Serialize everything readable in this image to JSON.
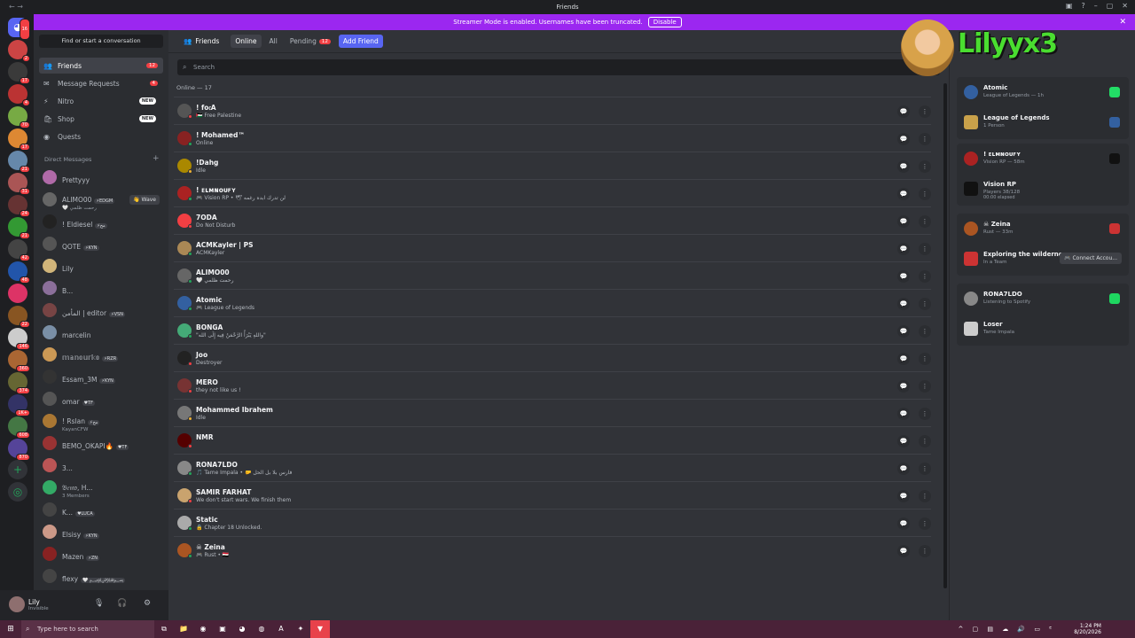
{
  "window": {
    "title": "Friends"
  },
  "banner": {
    "text": "Streamer Mode is enabled. Usernames have been truncated.",
    "disable_label": "Disable"
  },
  "rail": {
    "servers": [
      {
        "badge": "16",
        "color": "#5865f2",
        "home": true
      },
      {
        "badge": "2",
        "color": "#c44"
      },
      {
        "badge": "17",
        "color": "#3a3a3a"
      },
      {
        "badge": "4",
        "color": "#b33"
      },
      {
        "badge": "70",
        "color": "#7a4"
      },
      {
        "badge": "17",
        "color": "#d83"
      },
      {
        "badge": "21",
        "color": "#68a"
      },
      {
        "badge": "31",
        "color": "#a55"
      },
      {
        "badge": "24",
        "color": "#633"
      },
      {
        "badge": "21",
        "color": "#393"
      },
      {
        "badge": "42",
        "color": "#444"
      },
      {
        "badge": "48",
        "color": "#25a"
      },
      {
        "badge": "",
        "color": "#d36"
      },
      {
        "badge": "22",
        "color": "#852"
      },
      {
        "badge": "146",
        "color": "#ccc"
      },
      {
        "badge": "360",
        "color": "#a63"
      },
      {
        "badge": "374",
        "color": "#663"
      },
      {
        "badge": "1K+",
        "color": "#336"
      },
      {
        "badge": "608",
        "color": "#474"
      },
      {
        "badge": "870",
        "color": "#549"
      }
    ],
    "add_symbol": "+",
    "discover_symbol": "◎"
  },
  "sidebar": {
    "find_label": "Find or start a conversation",
    "nav": [
      {
        "label": "Friends",
        "icon": "👥",
        "pill": "12",
        "active": true
      },
      {
        "label": "Message Requests",
        "icon": "✉",
        "pill": "4"
      },
      {
        "label": "Nitro",
        "icon": "⚡",
        "new": "NEW"
      },
      {
        "label": "Shop",
        "icon": "🛍",
        "new": "NEW"
      },
      {
        "label": "Quests",
        "icon": "◉"
      }
    ],
    "dm_header": "Direct Messages",
    "dm_add": "+",
    "dms": [
      {
        "name": "Prettyyy",
        "color": "#b06aa8"
      },
      {
        "name": "ALIMO00",
        "tag": "⚡EDGM",
        "sub": "🤍 رحمت ظلمي",
        "wave": "👋 Wave",
        "color": "#666"
      },
      {
        "name": "! Eldiesel",
        "tag": "⚡مح",
        "color": "#222"
      },
      {
        "name": "QOTE",
        "tag": "⚡KYN",
        "color": "#555"
      },
      {
        "name": "Lily",
        "color": "#d1b57a"
      },
      {
        "name": "B...",
        "color": "#8b6f9a"
      },
      {
        "name": "المأمن | editor",
        "tag": "⚡VSN",
        "color": "#744"
      },
      {
        "name": "marcelin",
        "color": "#7a8fa6"
      },
      {
        "name": "𝕞𝕒𝕟𝕠𝕦𝕣𝕜𝕠",
        "tag": "⚡RZR",
        "color": "#c95"
      },
      {
        "name": "Essam_3M",
        "tag": "⚡KYN",
        "color": "#333"
      },
      {
        "name": "omar",
        "tag": "♥TF",
        "color": "#555"
      },
      {
        "name": "! Rslan",
        "tag": "⚡مح",
        "sub": "KayanCFW",
        "color": "#a73"
      },
      {
        "name": "BEMO_OKAPI🔥",
        "tag": "♥TF",
        "color": "#933"
      },
      {
        "name": "3...",
        "color": "#b55"
      },
      {
        "name": "𝔅𝔢𝔪𝔬, H...",
        "sub": "3 Members",
        "color": "#3a6"
      },
      {
        "name": "K...",
        "tag": "♥LUCA",
        "color": "#444"
      },
      {
        "name": "Elsisy",
        "tag": "⚡KYN",
        "color": "#c98"
      },
      {
        "name": "Mazen",
        "tag": "⚡ZN",
        "color": "#822"
      },
      {
        "name": "flexy",
        "tag": "🤍 ﷽",
        "color": "#444"
      }
    ]
  },
  "user": {
    "name": "Lily",
    "status": "Invisible",
    "mic": "🎙",
    "headset": "🎧",
    "settings": "⚙"
  },
  "topbar": {
    "friends_label": "Friends",
    "tabs": [
      "Online",
      "All"
    ],
    "pending_label": "Pending",
    "pending_count": "12",
    "add_friend_label": "Add Friend"
  },
  "search": {
    "placeholder": "Search"
  },
  "friends_count": "Online — 17",
  "friends": [
    {
      "name": "! fo𝔠A",
      "sub": "🇵🇸 Free Palestine",
      "color": "#555",
      "status": "#f23f43"
    },
    {
      "name": "! Mohamed™",
      "sub": "Online",
      "color": "#822",
      "status": "#23a55a"
    },
    {
      "name": "!Dahg",
      "sub": "Idle",
      "color": "#a80",
      "status": "#f0b232"
    },
    {
      "name": "! ᴇʟᴍɴᴏᴜꜰʏ",
      "sub": "🎮 Vision RP • 🕊 لن تدرك ابده رغمه",
      "color": "#a22",
      "status": "#23a55a"
    },
    {
      "name": "7ODA",
      "sub": "Do Not Disturb",
      "color": "#f23f43",
      "status": "#f23f43"
    },
    {
      "name": "ACMKayler | PS",
      "sub": "ACMKayler",
      "color": "#a85",
      "status": "#23a55a"
    },
    {
      "name": "ALIMO00",
      "sub": "🤍 رحمت ظلمي",
      "color": "#666",
      "status": "#23a55a"
    },
    {
      "name": "Atomic",
      "sub": "🎮 League of Legends",
      "color": "#3360a0",
      "status": "#23a55a"
    },
    {
      "name": "BONGA",
      "sub": "\"واللهِ يَبْرَأُ الرَّحْمَنُ فِيه إِلَى الله\"",
      "color": "#4a7",
      "status": "#23a55a"
    },
    {
      "name": "Joo",
      "sub": "Destroyer",
      "color": "#222",
      "status": "#f23f43"
    },
    {
      "name": "MERO",
      "sub": "they not like us !",
      "color": "#733",
      "status": "#f23f43"
    },
    {
      "name": "Mohammed Ibrahem",
      "sub": "Idle",
      "color": "#777",
      "status": "#f0b232"
    },
    {
      "name": "NMR",
      "sub": "",
      "color": "#500",
      "status": "#f23f43"
    },
    {
      "name": "RONA7LDO",
      "sub": "🎵 Tame Impala • 🤛 فارس بلا بل الحل",
      "color": "#888",
      "status": "#23a55a"
    },
    {
      "name": "SAMIR FARHAT",
      "sub": "We don't start wars. We finish them",
      "color": "#c9a36e",
      "status": "#f23f43"
    },
    {
      "name": "Static",
      "sub": "🔒 Chapter 18 Unlocked.",
      "color": "#aaa",
      "status": "#23a55a"
    },
    {
      "name": "☠ Zeina",
      "sub": "🎮 Rust • 🇪🇬",
      "color": "#a52",
      "status": "#23a55a"
    }
  ],
  "action_icons": {
    "message": "💬",
    "more": "⋮"
  },
  "activity": [
    {
      "rows": [
        {
          "t1": "Atomic",
          "t2": "League of Legends — 1h",
          "color": "#3360a0",
          "ric": "#2d6"
        },
        {
          "t1": "League of Legends",
          "t2": "1 Person",
          "color": "#c9a14a",
          "ric": "#3360a0"
        }
      ]
    },
    {
      "rows": [
        {
          "t1": "! ᴇʟᴍɴᴏᴜꜰʏ",
          "t2": "Vision RP — 58m",
          "color": "#a22",
          "ric": "#111"
        },
        {
          "t1": "Vision RP",
          "t2": "Players 38/128",
          "t3": "00:00 elapsed",
          "color": "#111"
        }
      ]
    },
    {
      "rows": [
        {
          "t1": "☠ Zeina",
          "t2": "Rust — 33m",
          "color": "#a52",
          "ric": "#c33"
        },
        {
          "t1": "Exploring the wilderness",
          "t2": "In a Team",
          "color": "#c33",
          "connect": "🎮 Connect Accou..."
        }
      ]
    },
    {
      "rows": [
        {
          "t1": "RONA7LDO",
          "t2": "Listening to Spotify",
          "color": "#888",
          "ric": "#1ed760"
        },
        {
          "t1": "Loser",
          "t2": "Tame Impala",
          "color": "#ccc"
        }
      ]
    }
  ],
  "overlay": {
    "logo": "Lilyyx3"
  },
  "taskbar": {
    "search_placeholder": "Type here to search",
    "time": "1:24 PM",
    "date": "8/20/2026",
    "tray": "^ ▢ ▤ ☁ 🔊 ▭ ᴱ"
  }
}
